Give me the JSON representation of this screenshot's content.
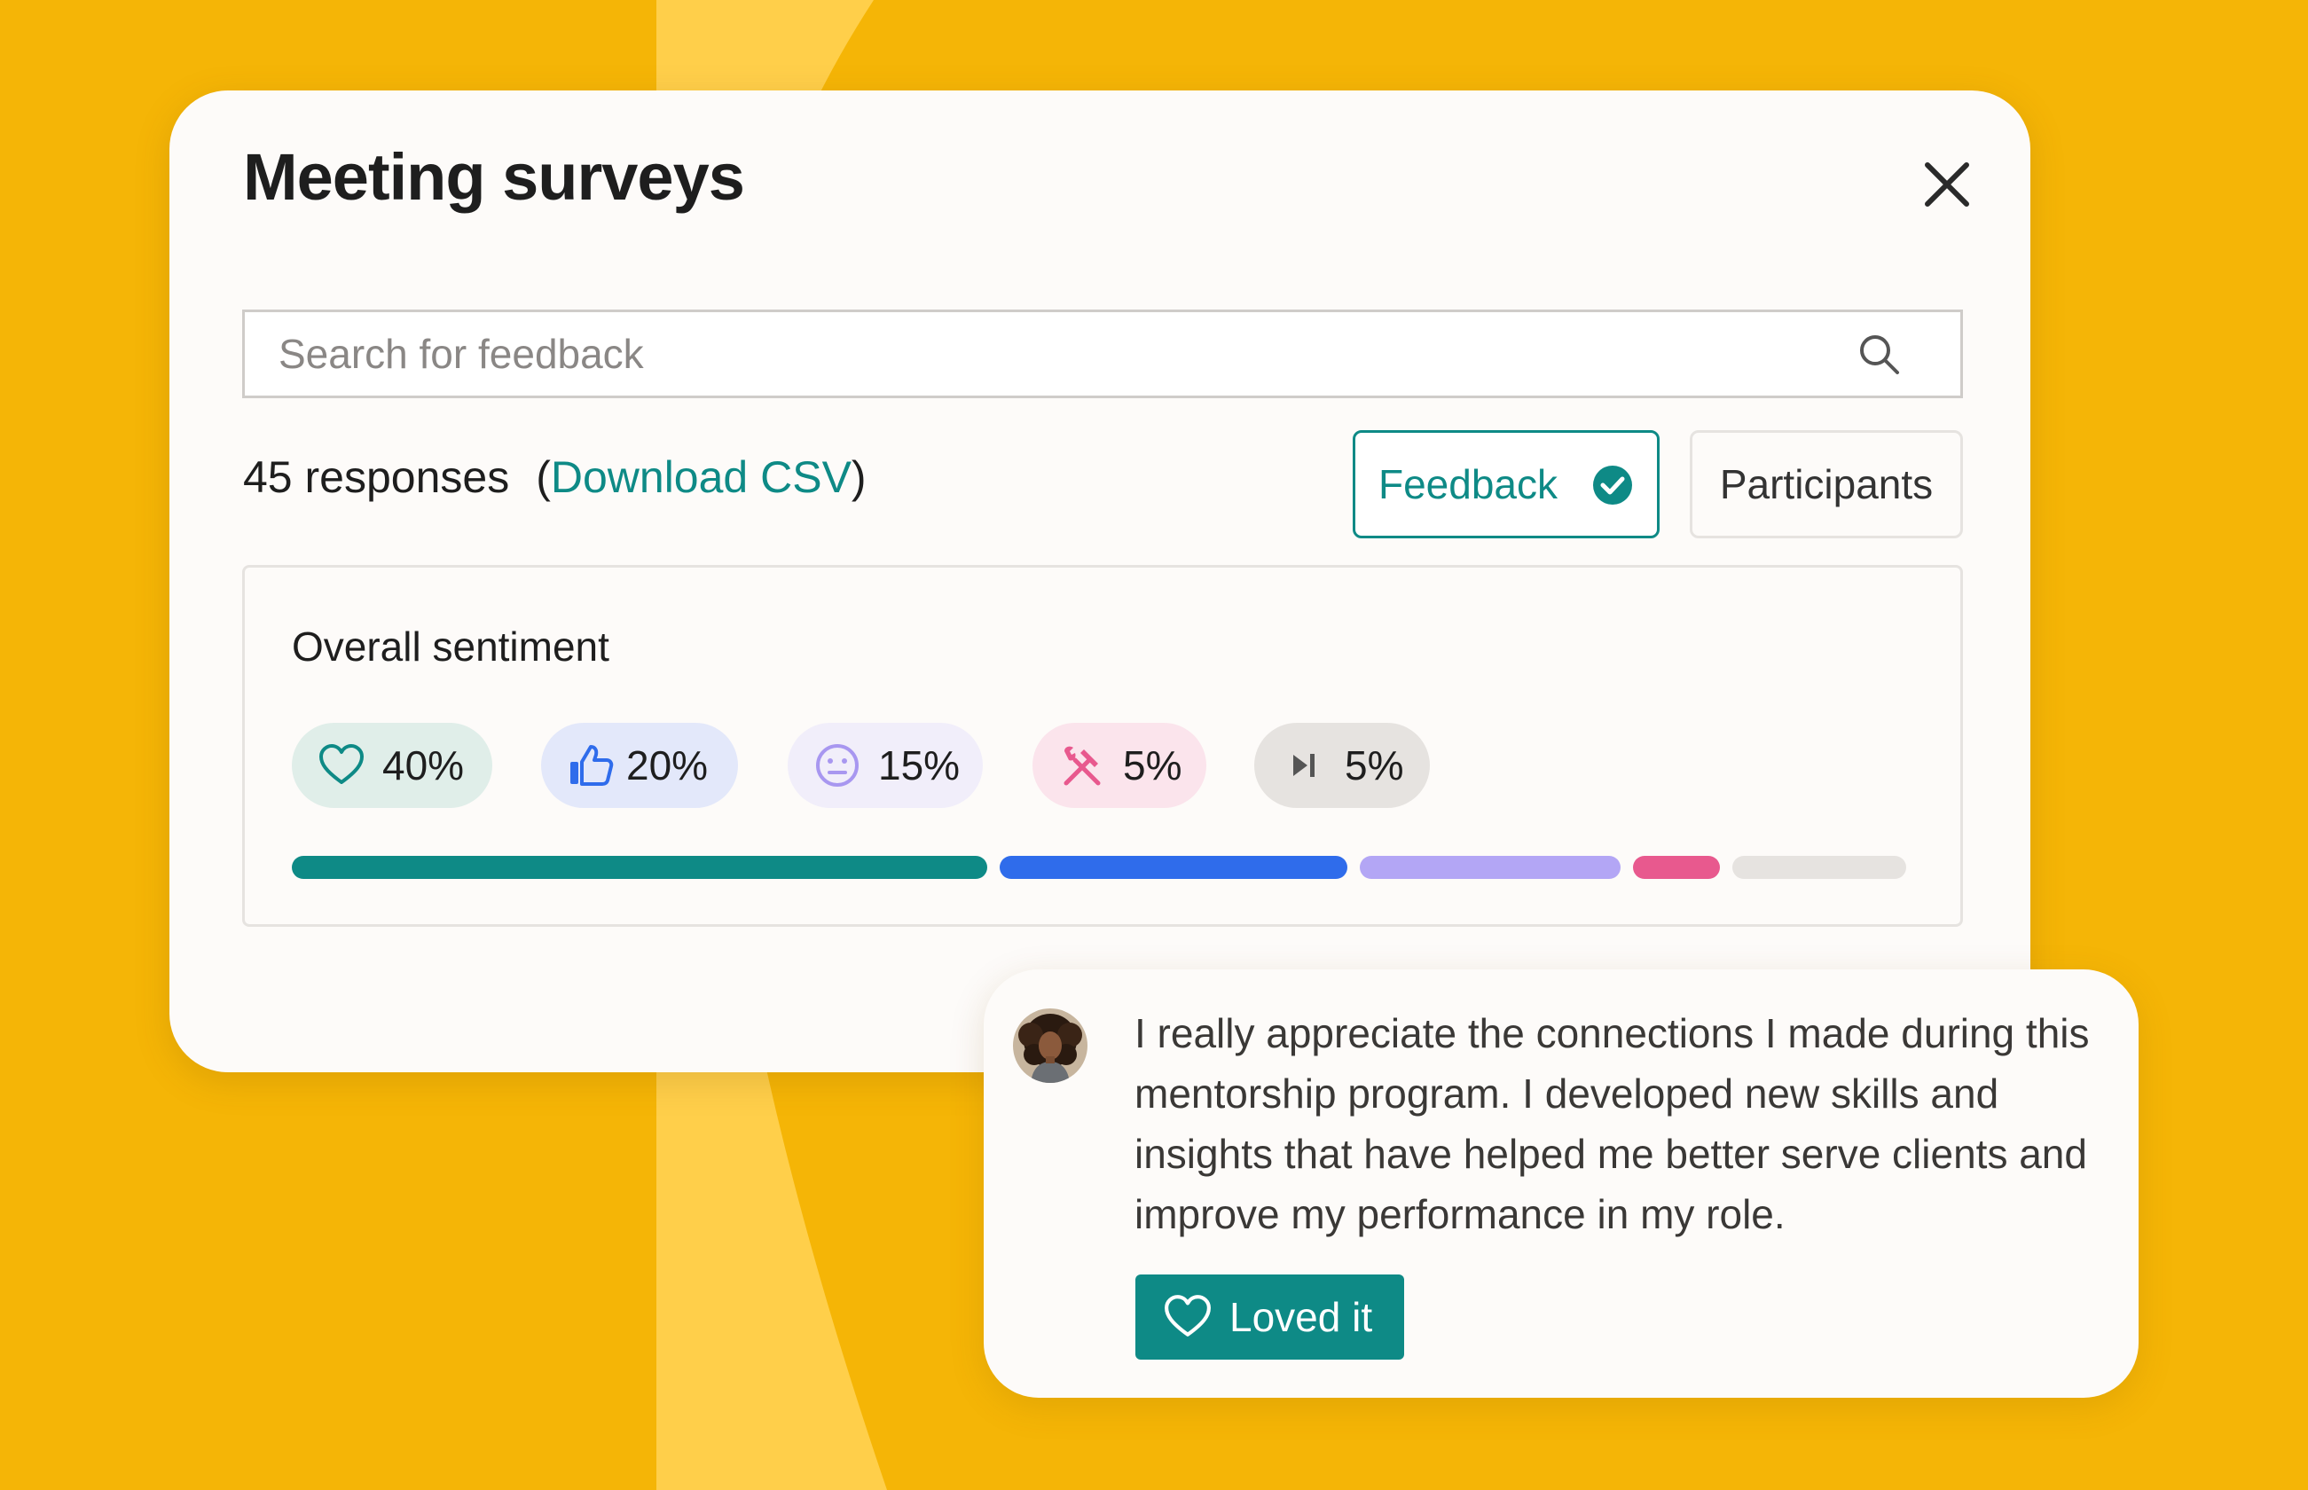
{
  "colors": {
    "background": "#F5B506",
    "arc": "#FFCF4A",
    "card": "#FDFBF9",
    "accent_teal": "#0E8A86",
    "accent_blue": "#2F6CEB",
    "accent_purple": "#B3A6F5",
    "accent_pink": "#E8598E",
    "neutral_gray": "#E6E3E0"
  },
  "modal": {
    "title": "Meeting surveys",
    "close_icon": "close-icon"
  },
  "search": {
    "placeholder": "Search for feedback",
    "value": "",
    "icon": "search-icon"
  },
  "responses": {
    "count_label": "45 responses",
    "paren_open": "(",
    "download_label": "Download CSV",
    "paren_close": ")"
  },
  "tabs": {
    "feedback_label": "Feedback",
    "feedback_icon": "check-circle-icon",
    "participants_label": "Participants"
  },
  "sentiment": {
    "title": "Overall sentiment",
    "items": [
      {
        "icon": "heart-icon",
        "percent": "40%",
        "value": 40,
        "color": "#0E8A86"
      },
      {
        "icon": "thumbs-up-icon",
        "percent": "20%",
        "value": 20,
        "color": "#2F6CEB"
      },
      {
        "icon": "neutral-face-icon",
        "percent": "15%",
        "value": 15,
        "color": "#B3A6F5"
      },
      {
        "icon": "tools-icon",
        "percent": "5%",
        "value": 5,
        "color": "#E8598E"
      },
      {
        "icon": "skip-icon",
        "percent": "5%",
        "value": 5,
        "color": "#E6E3E0"
      }
    ]
  },
  "comment": {
    "avatar_icon": "avatar",
    "text": "I really appreciate the connections I made during this mentorship program. I developed new skills and insights that have helped me better serve clients and improve my performance in my role.",
    "reaction_label": "Loved it",
    "reaction_icon": "heart-icon"
  }
}
